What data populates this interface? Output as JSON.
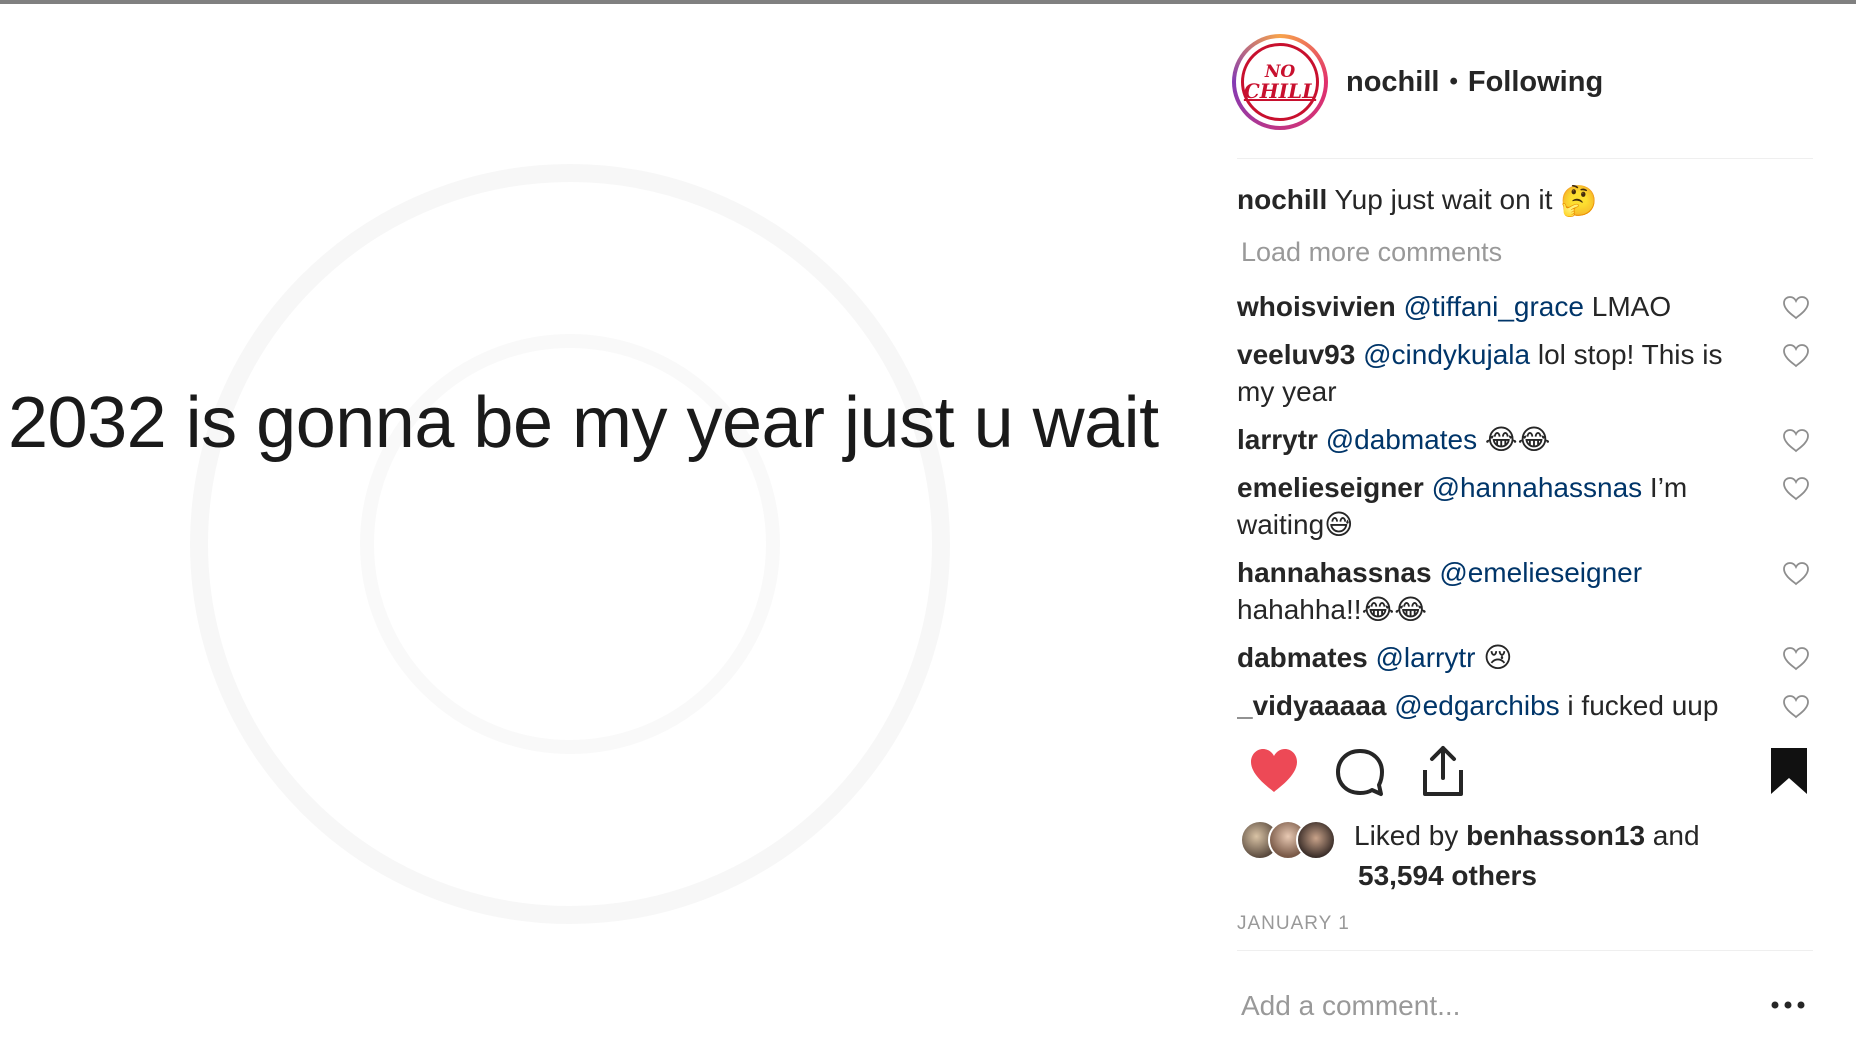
{
  "post": {
    "image_text": "2032 is gonna be my year just u wait"
  },
  "header": {
    "avatar_text_line1": "NO",
    "avatar_text_line2": "CHILL",
    "username": "nochill",
    "separator": "•",
    "follow_status": "Following"
  },
  "caption": {
    "username": "nochill",
    "text": "Yup just wait on it",
    "emoji": "🤔"
  },
  "load_more": "Load more comments",
  "comments": [
    {
      "user": "whoisvivien",
      "mention": "@tiffani_grace",
      "text": " LMAO"
    },
    {
      "user": "veeluv93",
      "mention": "@cindykujala",
      "text": " lol stop! This is my year"
    },
    {
      "user": "larrytr",
      "mention": "@dabmates",
      "text": " 😂😂"
    },
    {
      "user": "emelieseigner",
      "mention": "@hannahassnas",
      "text": " I’m waiting😅"
    },
    {
      "user": "hannahassnas",
      "mention": "@emelieseigner",
      "text": " hahahha!!😂😂"
    },
    {
      "user": "dabmates",
      "mention": "@larrytr",
      "text": " 😢"
    },
    {
      "user": "_vidyaaaaa",
      "mention": "@edgarchibs",
      "text": " i fucked uup"
    }
  ],
  "likes": {
    "prefix": "Liked by ",
    "user": "benhasson13",
    "middle": " and",
    "count": "53,594 others"
  },
  "date": "JANUARY 1",
  "add_comment": {
    "placeholder": "Add a comment..."
  },
  "colors": {
    "like_red": "#ed4956",
    "mention_blue": "#003569",
    "muted_gray": "#999999"
  },
  "icons": [
    "heart-icon",
    "comment-icon",
    "share-icon",
    "bookmark-icon",
    "more-options-icon"
  ]
}
